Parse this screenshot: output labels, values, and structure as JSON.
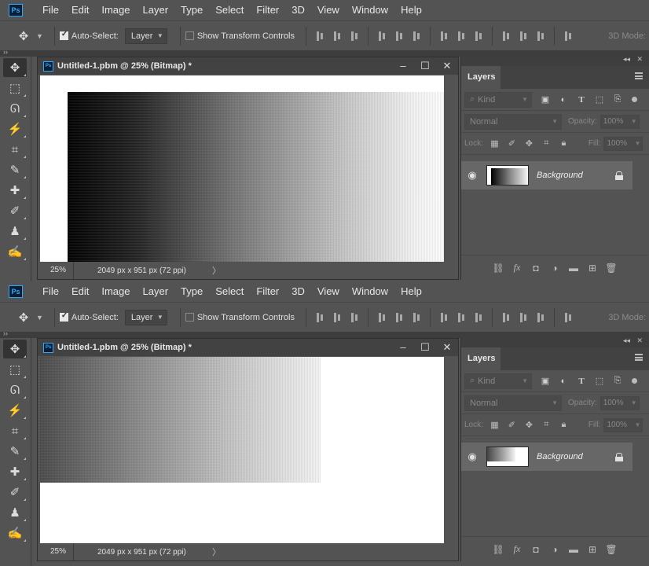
{
  "app": {
    "logo_text": "Ps",
    "menu": [
      "File",
      "Edit",
      "Image",
      "Layer",
      "Type",
      "Select",
      "Filter",
      "3D",
      "View",
      "Window",
      "Help"
    ]
  },
  "options_bar": {
    "auto_select_label": "Auto-Select:",
    "auto_select_checked": true,
    "auto_select_target": "Layer",
    "show_transform_label": "Show Transform Controls",
    "show_transform_checked": false,
    "three_d_mode_label": "3D Mode:"
  },
  "tools": [
    "move-tool",
    "marquee-tool",
    "lasso-tool",
    "magic-wand-tool",
    "crop-tool",
    "eyedropper-tool",
    "healing-brush-tool",
    "brush-tool",
    "clone-stamp-tool",
    "history-brush-tool"
  ],
  "document": {
    "title": "Untitled-1.pbm @ 25% (Bitmap) *",
    "zoom": "25%",
    "doc_info": "2049 px x 951 px (72 ppi)"
  },
  "layers_panel": {
    "tab_label": "Layers",
    "kind_placeholder": "Kind",
    "blend_mode": "Normal",
    "opacity_label": "Opacity:",
    "opacity_value": "100%",
    "lock_label": "Lock:",
    "fill_label": "Fill:",
    "fill_value": "100%",
    "layer_name": "Background",
    "layer_locked": true
  },
  "colors": {
    "ui_bg": "#535353",
    "titlebar": "#424242",
    "ps_blue": "#31a8ff",
    "selected_layer": "#676767"
  },
  "instances": [
    {
      "id": "top",
      "gradient": "dark-to-light full canvas"
    },
    {
      "id": "bottom",
      "gradient": "gradient shifted into top-left region"
    }
  ]
}
